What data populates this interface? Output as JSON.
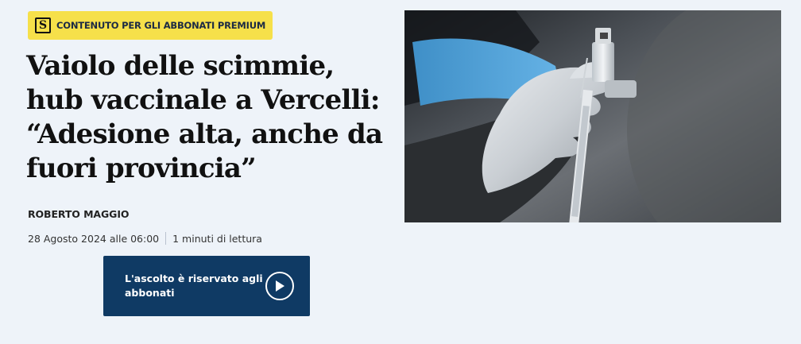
{
  "badge": {
    "logo_letter": "S",
    "label": "CONTENUTO PER GLI ABBONATI PREMIUM"
  },
  "article": {
    "title": "Vaiolo delle scimmie, hub vaccinale a Vercelli: “Adesione alta, anche da fuori provincia”",
    "author": "ROBERTO MAGGIO",
    "date": "28 Agosto 2024 alle 06:00",
    "reading_time": "1 minuti di lettura"
  },
  "audio": {
    "label": "L'ascolto è riservato agli abbonati",
    "icon": "play-icon"
  },
  "image": {
    "icon": "vaccine-syringe-photo"
  },
  "colors": {
    "badge_bg": "#f6e04a",
    "audio_bg": "#0f3a64",
    "page_bg": "#eef3f9"
  }
}
